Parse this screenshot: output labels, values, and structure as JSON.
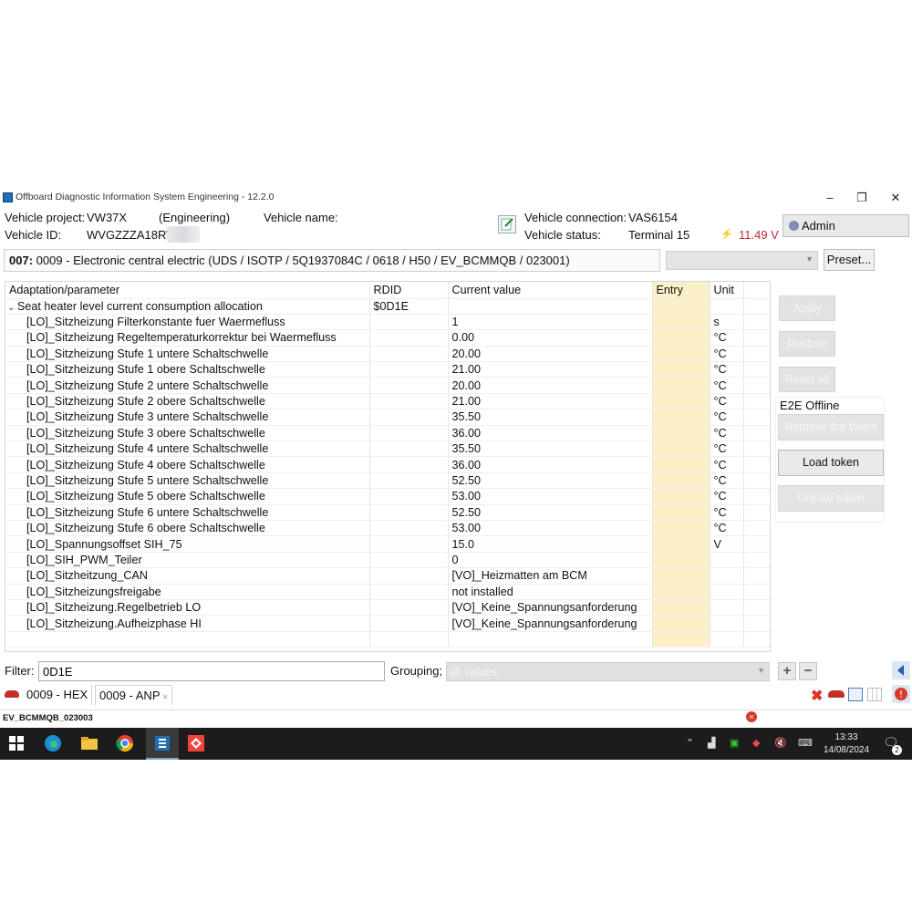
{
  "window": {
    "title": "Offboard Diagnostic Information System Engineering - 12.2.0",
    "minimize": "–",
    "maximize": "❐",
    "close": "✕"
  },
  "header": {
    "project_label": "Vehicle project:",
    "project_value": "VW37X",
    "project_mode": "(Engineering)",
    "vehicle_name_label": "Vehicle name:",
    "vehicle_name_value": "",
    "vehicle_id_label": "Vehicle ID:",
    "vehicle_id_value": "WVGZZZA18RW",
    "connection_label": "Vehicle connection:",
    "connection_value": "VAS6154",
    "status_label": "Vehicle status:",
    "status_value": "Terminal 15",
    "voltage": "11.49 V",
    "user": "Admin"
  },
  "ecu": {
    "address": "007:",
    "description": "0009 - Electronic central electric  (UDS / ISOTP / 5Q1937084C / 0618 / H50 / EV_BCMMQB / 023001)",
    "preset_label": "Preset..."
  },
  "table": {
    "columns": [
      "Adaptation/parameter",
      "RDID",
      "Current value",
      "Entry",
      "Unit"
    ],
    "group": {
      "name": "Seat heater level current consumption allocation",
      "rdid": "$0D1E"
    },
    "rows": [
      {
        "param": "[LO]_Sitzheizung Filterkonstante fuer Waermefluss",
        "value": "1",
        "unit": "s"
      },
      {
        "param": "[LO]_Sitzheizung Regeltemperaturkorrektur bei Waermefluss",
        "value": "0.00",
        "unit": "°C"
      },
      {
        "param": "[LO]_Sitzheizung Stufe 1 untere Schaltschwelle",
        "value": "20.00",
        "unit": "°C"
      },
      {
        "param": "[LO]_Sitzheizung Stufe 1 obere Schaltschwelle",
        "value": "21.00",
        "unit": "°C"
      },
      {
        "param": "[LO]_Sitzheizung Stufe 2 untere Schaltschwelle",
        "value": "20.00",
        "unit": "°C"
      },
      {
        "param": "[LO]_Sitzheizung Stufe 2 obere Schaltschwelle",
        "value": "21.00",
        "unit": "°C"
      },
      {
        "param": "[LO]_Sitzheizung Stufe 3 untere Schaltschwelle",
        "value": "35.50",
        "unit": "°C"
      },
      {
        "param": "[LO]_Sitzheizung Stufe 3 obere Schaltschwelle",
        "value": "36.00",
        "unit": "°C"
      },
      {
        "param": "[LO]_Sitzheizung Stufe 4 untere Schaltschwelle",
        "value": "35.50",
        "unit": "°C"
      },
      {
        "param": "[LO]_Sitzheizung Stufe 4 obere Schaltschwelle",
        "value": "36.00",
        "unit": "°C"
      },
      {
        "param": "[LO]_Sitzheizung Stufe 5 untere Schaltschwelle",
        "value": "52.50",
        "unit": "°C"
      },
      {
        "param": "[LO]_Sitzheizung Stufe 5 obere Schaltschwelle",
        "value": "53.00",
        "unit": "°C"
      },
      {
        "param": "[LO]_Sitzheizung Stufe 6 untere Schaltschwelle",
        "value": "52.50",
        "unit": "°C"
      },
      {
        "param": "[LO]_Sitzheizung Stufe 6 obere Schaltschwelle",
        "value": "53.00",
        "unit": "°C"
      },
      {
        "param": "[LO]_Spannungsoffset SIH_75",
        "value": "15.0",
        "unit": "V"
      },
      {
        "param": "[LO]_SIH_PWM_Teiler",
        "value": "0",
        "unit": ""
      },
      {
        "param": "[LO]_Sitzheitzung_CAN",
        "value": "[VO]_Heizmatten am BCM",
        "unit": ""
      },
      {
        "param": "[LO]_Sitzheizungsfreigabe",
        "value": "not installed",
        "unit": ""
      },
      {
        "param": "[LO]_Sitzheizung.Regelbetrieb LO",
        "value": "[VO]_Keine_Spannungsanforderung",
        "unit": ""
      },
      {
        "param": "[LO]_Sitzheizung.Aufheizphase HI",
        "value": "[VO]_Keine_Spannungsanforderung",
        "unit": ""
      }
    ]
  },
  "right_panel": {
    "apply": "Apply",
    "restore": "Restore",
    "reset_all": "Reset all",
    "e2e_status": "E2E Offline",
    "retrieve_token": "Retrieve the token",
    "load_token": "Load token",
    "unload_token": "Unload token"
  },
  "filter": {
    "label": "Filter:",
    "value": "0D1E",
    "grouping_label": "Grouping;",
    "grouping_value": "all values",
    "add": "+",
    "remove": "−"
  },
  "tabs": [
    {
      "label": "0009 - HEX"
    },
    {
      "label": "0009 - ANP",
      "close": "×"
    }
  ],
  "status_bar": {
    "text": "EV_BCMMQB_023003"
  },
  "taskbar": {
    "time": "13:33",
    "date": "14/08/2024",
    "notifications": "2"
  },
  "colors": {
    "entry_column": "#fbf0c8",
    "voltage": "#c0282d",
    "taskbar": "#1c1c1c"
  }
}
